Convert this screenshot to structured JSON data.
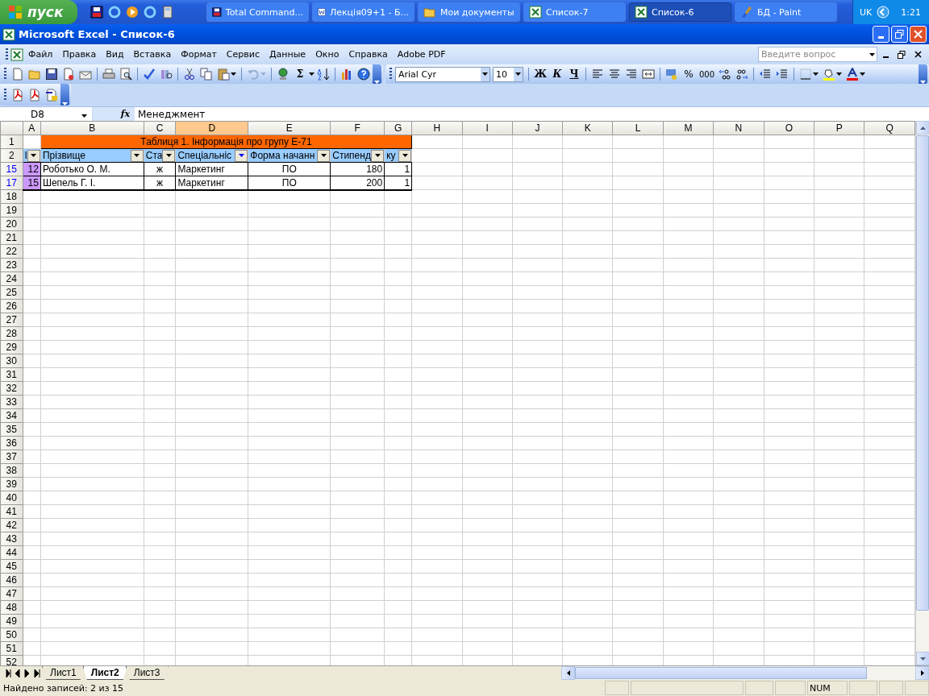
{
  "taskbar": {
    "start": "пуск",
    "tasks": [
      {
        "label": "Total Command...",
        "selected": false,
        "kind": "disk"
      },
      {
        "label": "Лекція09+1 - Б...",
        "selected": false,
        "kind": "word"
      },
      {
        "label": "Мои документы",
        "selected": false,
        "kind": "folder"
      },
      {
        "label": "Список-7",
        "selected": false,
        "kind": "excel"
      },
      {
        "label": "Список-6",
        "selected": true,
        "kind": "excel"
      },
      {
        "label": "БД - Paint",
        "selected": false,
        "kind": "paint"
      }
    ],
    "lang": "UK",
    "clock": "1:21"
  },
  "window": {
    "title": "Microsoft Excel - Список-6"
  },
  "menu": [
    "Файл",
    "Правка",
    "Вид",
    "Вставка",
    "Формат",
    "Сервис",
    "Данные",
    "Окно",
    "Справка",
    "Adobe PDF"
  ],
  "help": {
    "placeholder": "Введите вопрос"
  },
  "toolbar": {
    "sum": "Σ",
    "font": "Arial Cyr",
    "size": "10",
    "bold": "Ж",
    "italic": "К",
    "underline": "Ч",
    "percent": "%",
    "thousands": "000"
  },
  "formula_bar": {
    "name_box": "D8",
    "fx": "fx",
    "value": "Менеджмент"
  },
  "columns": [
    {
      "label": "A",
      "selected": false
    },
    {
      "label": "B",
      "selected": false
    },
    {
      "label": "C",
      "selected": false
    },
    {
      "label": "D",
      "selected": true
    },
    {
      "label": "E",
      "selected": false
    },
    {
      "label": "F",
      "selected": false
    },
    {
      "label": "G",
      "selected": false
    },
    {
      "label": "H",
      "selected": false
    },
    {
      "label": "I",
      "selected": false
    },
    {
      "label": "J",
      "selected": false
    },
    {
      "label": "K",
      "selected": false
    },
    {
      "label": "L",
      "selected": false
    },
    {
      "label": "M",
      "selected": false
    },
    {
      "label": "N",
      "selected": false
    },
    {
      "label": "O",
      "selected": false
    },
    {
      "label": "P",
      "selected": false
    },
    {
      "label": "Q",
      "selected": false
    }
  ],
  "title_row": {
    "num": "1",
    "text": "Таблиця 1. Інформація про групу Е-71"
  },
  "header_row": {
    "num": "2",
    "cells": [
      {
        "text": "І",
        "filter_active": false
      },
      {
        "text": "Прізвище",
        "filter_active": false
      },
      {
        "text": "Ста",
        "filter_active": false
      },
      {
        "text": "Спеціальніс",
        "filter_active": true
      },
      {
        "text": "Форма начанн",
        "filter_active": false
      },
      {
        "text": "Стипенд",
        "filter_active": false
      },
      {
        "text": "ку",
        "filter_active": false
      }
    ]
  },
  "rows": [
    {
      "num": "15",
      "filtered": true,
      "cells": [
        "12",
        "Роботько О. М.",
        "ж",
        "Маркетинг",
        "ПО",
        "180",
        "1"
      ]
    },
    {
      "num": "17",
      "filtered": true,
      "cells": [
        "15",
        "Шепель Г. І.",
        "ж",
        "Маркетинг",
        "ПО",
        "200",
        "1"
      ]
    }
  ],
  "empty_rows": [
    "18",
    "19",
    "20",
    "21",
    "22",
    "23",
    "24",
    "25",
    "26",
    "27",
    "28",
    "29",
    "30",
    "31",
    "32",
    "33",
    "34",
    "35",
    "36",
    "37",
    "38",
    "39",
    "40",
    "41",
    "42",
    "43",
    "44",
    "45",
    "46",
    "47",
    "48",
    "49",
    "50",
    "51",
    "52"
  ],
  "sheet_tabs": [
    {
      "label": "Лист1",
      "selected": false
    },
    {
      "label": "Лист2",
      "selected": true
    },
    {
      "label": "Лист3",
      "selected": false
    }
  ],
  "status_bar": {
    "message": "Найдено записей: 2 из 15",
    "num": "NUM"
  }
}
